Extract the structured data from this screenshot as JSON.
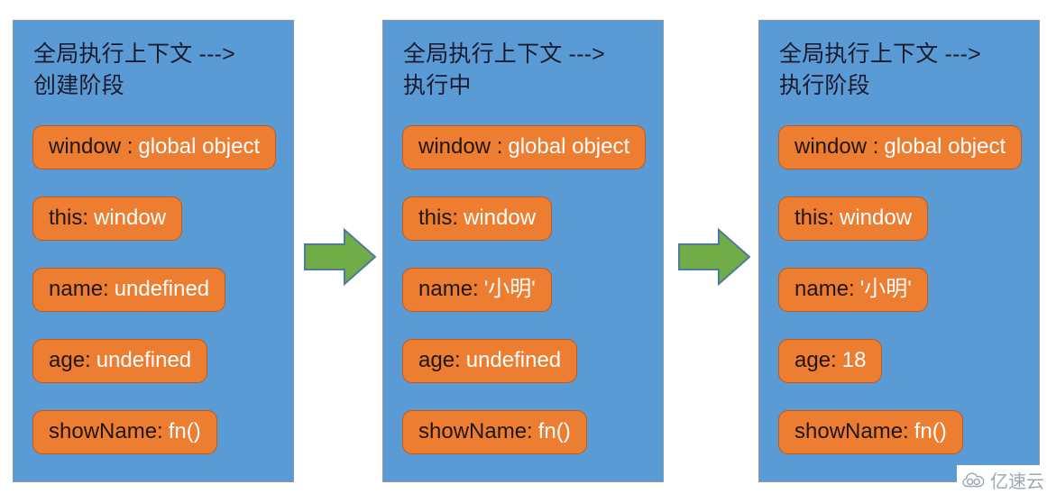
{
  "diagram": {
    "type": "three-stage-execution-context",
    "colors": {
      "panel_background": "#5B9BD5",
      "panel_border": "#8C9AA8",
      "pill_background": "#ED7D31",
      "pill_border": "#C25A16",
      "pill_key_text": "#20160C",
      "pill_value_text": "#FFFFFF",
      "arrow_fill": "#70AD47",
      "arrow_stroke": "#4E7A9B",
      "page_background": "#FFFFFF",
      "watermark_text": "#9AA7B4"
    },
    "panels": [
      {
        "title": "全局执行上下文 --->\n创建阶段",
        "title_line1": "全局执行上下文 --->",
        "title_line2": "创建阶段",
        "items": [
          {
            "key": "window :",
            "value": "global object"
          },
          {
            "key": "this:",
            "value": "window"
          },
          {
            "key": "name:",
            "value": "undefined"
          },
          {
            "key": "age:",
            "value": "undefined"
          },
          {
            "key": "showName:",
            "value": "fn()"
          }
        ]
      },
      {
        "title": "全局执行上下文 --->\n执行中",
        "title_line1": "全局执行上下文 --->",
        "title_line2": "执行中",
        "items": [
          {
            "key": "window :",
            "value": "global object"
          },
          {
            "key": "this:",
            "value": "window"
          },
          {
            "key": "name:",
            "value": "'小明'"
          },
          {
            "key": "age:",
            "value": "undefined"
          },
          {
            "key": "showName:",
            "value": "fn()"
          }
        ]
      },
      {
        "title": "全局执行上下文 --->\n执行阶段",
        "title_line1": "全局执行上下文 --->",
        "title_line2": "执行阶段",
        "items": [
          {
            "key": "window :",
            "value": "global object"
          },
          {
            "key": "this:",
            "value": "window"
          },
          {
            "key": "name:",
            "value": "'小明'"
          },
          {
            "key": "age:",
            "value": "18"
          },
          {
            "key": "showName:",
            "value": "fn()"
          }
        ]
      }
    ],
    "arrows": [
      {
        "label": "right-arrow",
        "direction": "right"
      },
      {
        "label": "right-arrow",
        "direction": "right"
      }
    ],
    "watermark": {
      "text": "亿速云",
      "icon": "cloud-logo-icon"
    }
  }
}
